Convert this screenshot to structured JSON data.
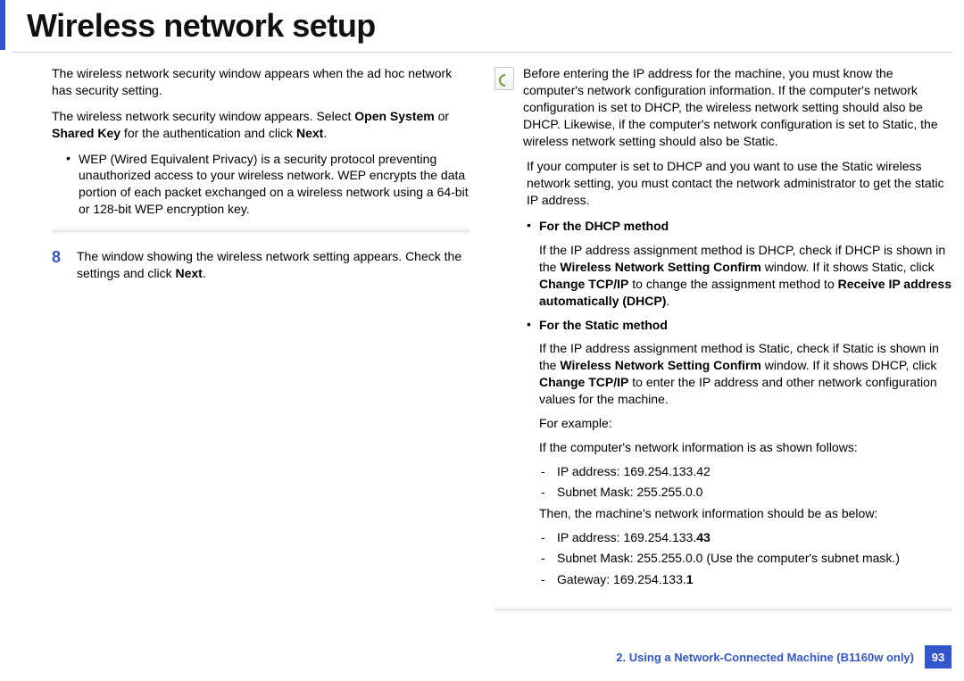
{
  "title": "Wireless network setup",
  "left": {
    "p1": "The wireless network security window appears when the ad hoc network has security setting.",
    "p2a": "The wireless network security window appears. Select ",
    "p2b1": "Open System",
    "p2c": " or ",
    "p2b2": "Shared Key",
    "p2d": " for the authentication and click ",
    "p2b3": "Next",
    "p2e": ".",
    "bullet1": "WEP (Wired Equivalent Privacy) is a security protocol preventing unauthorized access to your wireless network. WEP encrypts the data portion of each packet exchanged on a wireless network using a 64-bit or 128-bit WEP encryption key.",
    "stepNum": "8",
    "stepA": "The window showing the wireless network setting appears. Check the settings and click ",
    "stepB": "Next",
    "stepC": "."
  },
  "right": {
    "note": "Before entering the IP address for the machine, you must know the computer's network configuration information. If the computer's network configuration is set to DHCP, the wireless network setting should also be DHCP. Likewise, if the computer's network configuration is set to Static, the wireless network setting should also be Static.",
    "p2": "If your computer is set to DHCP and you want to use the Static wireless network setting, you must contact the network administrator to get the static IP address.",
    "dhcpHead": "For the DHCP method",
    "dhcpA": "If the IP address assignment method is DHCP, check if DHCP is shown in the ",
    "dhcpB1": "Wireless Network Setting Confirm",
    "dhcpC": " window. If it shows Static, click ",
    "dhcpB2": "Change TCP/IP",
    "dhcpD": " to change the assignment method to ",
    "dhcpB3": "Receive IP address automatically (DHCP)",
    "dhcpE": ".",
    "staticHead": "For the Static method",
    "stA": "If the IP address assignment method is Static, check if Static is shown in the ",
    "stB1": "Wireless Network Setting Confirm",
    "stC": " window. If it shows DHCP, click ",
    "stB2": "Change TCP/IP",
    "stD": " to enter the IP address and other network configuration values for the machine.",
    "ex": "For example:",
    "exIntro": "If the computer's network information is as shown follows:",
    "compIP": "IP address: 169.254.133.42",
    "compMask": "Subnet Mask: 255.255.0.0",
    "then": "Then, the machine's network information should be as below:",
    "mIPa": "IP address: 169.254.133.",
    "mIPb": "43",
    "mMask": "Subnet Mask: 255.255.0.0 (Use the computer's subnet mask.)",
    "mGWa": "Gateway: 169.254.133.",
    "mGWb": "1"
  },
  "footer": {
    "chapter": "2.  Using a Network-Connected Machine (B1160w only)",
    "page": "93"
  }
}
